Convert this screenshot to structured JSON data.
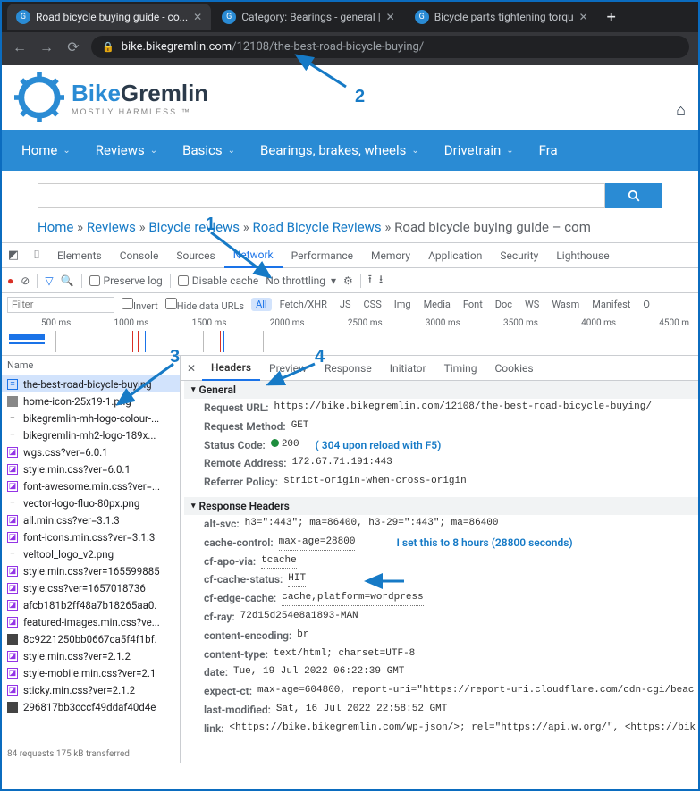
{
  "browser": {
    "tabs": [
      {
        "title": "Road bicycle buying guide - co..."
      },
      {
        "title": "Category: Bearings - general |"
      },
      {
        "title": "Bicycle parts tightening torqu"
      }
    ],
    "url_host": "bike.bikegremlin.com",
    "url_path": "/12108/the-best-road-bicycle-buying/"
  },
  "site": {
    "brand_a": "Bike",
    "brand_b": "Gremlin",
    "tagline": "MOSTLY HARMLESS ™",
    "nav": [
      "Home",
      "Reviews",
      "Basics",
      "Bearings, brakes, wheels",
      "Drivetrain",
      "Fra"
    ]
  },
  "breadcrumb": {
    "items": [
      "Home",
      "Reviews",
      "Bicycle reviews",
      "Road Bicycle Reviews"
    ],
    "sep": "»",
    "tail": "Road bicycle buying guide – com"
  },
  "devtools": {
    "tabs": [
      "Elements",
      "Console",
      "Sources",
      "Network",
      "Performance",
      "Memory",
      "Application",
      "Security",
      "Lighthouse"
    ],
    "active_tab": "Network",
    "toolbar": {
      "preserve": "Preserve log",
      "disable_cache": "Disable cache",
      "throttling": "No throttling"
    },
    "filter": {
      "placeholder": "Filter",
      "invert": "Invert",
      "hide_urls": "Hide data URLs",
      "types": [
        "All",
        "Fetch/XHR",
        "JS",
        "CSS",
        "Img",
        "Media",
        "Font",
        "Doc",
        "WS",
        "Wasm",
        "Manifest",
        "O"
      ]
    },
    "timeline_ticks": [
      "500 ms",
      "1000 ms",
      "1500 ms",
      "2000 ms",
      "2500 ms",
      "3000 ms",
      "3500 ms",
      "4000 ms",
      "4500 m"
    ],
    "name_col": "Name",
    "requests": [
      {
        "ico": "doc",
        "name": "the-best-road-bicycle-buying"
      },
      {
        "ico": "img",
        "name": "home-icon-25x19-1.png"
      },
      {
        "ico": "dash",
        "name": "bikegremlin-mh-logo-colour-..."
      },
      {
        "ico": "dash",
        "name": "bikegremlin-mh2-logo-189x..."
      },
      {
        "ico": "css",
        "name": "wgs.css?ver=6.0.1"
      },
      {
        "ico": "css",
        "name": "style.min.css?ver=6.0.1"
      },
      {
        "ico": "css",
        "name": "font-awesome.min.css?ver=..."
      },
      {
        "ico": "dash",
        "name": "vector-logo-fluo-80px.png"
      },
      {
        "ico": "css",
        "name": "all.min.css?ver=3.1.3"
      },
      {
        "ico": "css",
        "name": "font-icons.min.css?ver=3.1.3"
      },
      {
        "ico": "dash",
        "name": "veltool_logo_v2.png"
      },
      {
        "ico": "css",
        "name": "style.min.css?ver=165599885"
      },
      {
        "ico": "css",
        "name": "style.css?ver=1657018736"
      },
      {
        "ico": "css",
        "name": "afcb181b2ff48a7b18265aa0."
      },
      {
        "ico": "css",
        "name": "featured-images.min.css?ve..."
      },
      {
        "ico": "dkimg",
        "name": "8c9221250bb0667ca5f4f1bf."
      },
      {
        "ico": "css",
        "name": "style.min.css?ver=2.1.2"
      },
      {
        "ico": "css",
        "name": "style-mobile.min.css?ver=2.1"
      },
      {
        "ico": "css",
        "name": "sticky.min.css?ver=2.1.2"
      },
      {
        "ico": "dkimg",
        "name": "296817bb3cccf49ddaf40d4e"
      }
    ],
    "requests_footer": "84 requests    175 kB transferred",
    "detail_tabs": [
      "Headers",
      "Preview",
      "Response",
      "Initiator",
      "Timing",
      "Cookies"
    ],
    "detail_active": "Headers",
    "general_h": "General",
    "general": {
      "url_k": "Request URL:",
      "url_v": "https://bike.bikegremlin.com/12108/the-best-road-bicycle-buying/",
      "method_k": "Request Method:",
      "method_v": "GET",
      "status_k": "Status Code:",
      "status_v": "200",
      "status_note": "( 304 upon reload with F5)",
      "remote_k": "Remote Address:",
      "remote_v": "172.67.71.191:443",
      "ref_k": "Referrer Policy:",
      "ref_v": "strict-origin-when-cross-origin"
    },
    "response_h": "Response Headers",
    "response": [
      {
        "k": "alt-svc:",
        "v": "h3=\":443\"; ma=86400, h3-29=\":443\"; ma=86400"
      },
      {
        "k": "cache-control:",
        "v": "max-age=28800",
        "u": true,
        "note": "I set this to 8 hours (28800 seconds)"
      },
      {
        "k": "cf-apo-via:",
        "v": "tcache",
        "u": true
      },
      {
        "k": "cf-cache-status:",
        "v": "HIT",
        "u": true
      },
      {
        "k": "cf-edge-cache:",
        "v": "cache,platform=wordpress",
        "u": true
      },
      {
        "k": "cf-ray:",
        "v": "72d15d254e8a1893-MAN"
      },
      {
        "k": "content-encoding:",
        "v": "br"
      },
      {
        "k": "content-type:",
        "v": "text/html; charset=UTF-8"
      },
      {
        "k": "date:",
        "v": "Tue, 19 Jul 2022 06:22:39 GMT"
      },
      {
        "k": "expect-ct:",
        "v": "max-age=604800, report-uri=\"https://report-uri.cloudflare.com/cdn-cgi/beac"
      },
      {
        "k": "last-modified:",
        "v": "Sat, 16 Jul 2022 22:58:52 GMT"
      },
      {
        "k": "link:",
        "v": "<https://bike.bikegremlin.com/wp-json/>; rel=\"https://api.w.org/\", <https://bik"
      }
    ]
  },
  "anno": {
    "n1": "1",
    "n2": "2",
    "n3": "3",
    "n4": "4"
  }
}
